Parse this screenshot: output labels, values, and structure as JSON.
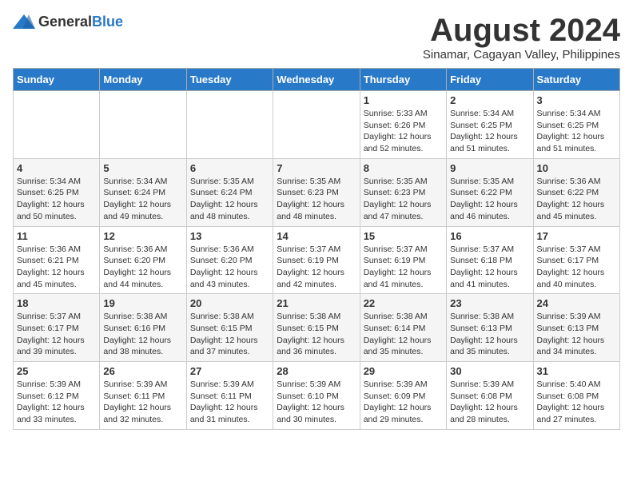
{
  "header": {
    "logo": {
      "general": "General",
      "blue": "Blue"
    },
    "title": "August 2024",
    "subtitle": "Sinamar, Cagayan Valley, Philippines"
  },
  "weekdays": [
    "Sunday",
    "Monday",
    "Tuesday",
    "Wednesday",
    "Thursday",
    "Friday",
    "Saturday"
  ],
  "weeks": [
    [
      {
        "day": "",
        "sunrise": "",
        "sunset": "",
        "daylight": ""
      },
      {
        "day": "",
        "sunrise": "",
        "sunset": "",
        "daylight": ""
      },
      {
        "day": "",
        "sunrise": "",
        "sunset": "",
        "daylight": ""
      },
      {
        "day": "",
        "sunrise": "",
        "sunset": "",
        "daylight": ""
      },
      {
        "day": "1",
        "sunrise": "Sunrise: 5:33 AM",
        "sunset": "Sunset: 6:26 PM",
        "daylight": "Daylight: 12 hours and 52 minutes."
      },
      {
        "day": "2",
        "sunrise": "Sunrise: 5:34 AM",
        "sunset": "Sunset: 6:25 PM",
        "daylight": "Daylight: 12 hours and 51 minutes."
      },
      {
        "day": "3",
        "sunrise": "Sunrise: 5:34 AM",
        "sunset": "Sunset: 6:25 PM",
        "daylight": "Daylight: 12 hours and 51 minutes."
      }
    ],
    [
      {
        "day": "4",
        "sunrise": "Sunrise: 5:34 AM",
        "sunset": "Sunset: 6:25 PM",
        "daylight": "Daylight: 12 hours and 50 minutes."
      },
      {
        "day": "5",
        "sunrise": "Sunrise: 5:34 AM",
        "sunset": "Sunset: 6:24 PM",
        "daylight": "Daylight: 12 hours and 49 minutes."
      },
      {
        "day": "6",
        "sunrise": "Sunrise: 5:35 AM",
        "sunset": "Sunset: 6:24 PM",
        "daylight": "Daylight: 12 hours and 48 minutes."
      },
      {
        "day": "7",
        "sunrise": "Sunrise: 5:35 AM",
        "sunset": "Sunset: 6:23 PM",
        "daylight": "Daylight: 12 hours and 48 minutes."
      },
      {
        "day": "8",
        "sunrise": "Sunrise: 5:35 AM",
        "sunset": "Sunset: 6:23 PM",
        "daylight": "Daylight: 12 hours and 47 minutes."
      },
      {
        "day": "9",
        "sunrise": "Sunrise: 5:35 AM",
        "sunset": "Sunset: 6:22 PM",
        "daylight": "Daylight: 12 hours and 46 minutes."
      },
      {
        "day": "10",
        "sunrise": "Sunrise: 5:36 AM",
        "sunset": "Sunset: 6:22 PM",
        "daylight": "Daylight: 12 hours and 45 minutes."
      }
    ],
    [
      {
        "day": "11",
        "sunrise": "Sunrise: 5:36 AM",
        "sunset": "Sunset: 6:21 PM",
        "daylight": "Daylight: 12 hours and 45 minutes."
      },
      {
        "day": "12",
        "sunrise": "Sunrise: 5:36 AM",
        "sunset": "Sunset: 6:20 PM",
        "daylight": "Daylight: 12 hours and 44 minutes."
      },
      {
        "day": "13",
        "sunrise": "Sunrise: 5:36 AM",
        "sunset": "Sunset: 6:20 PM",
        "daylight": "Daylight: 12 hours and 43 minutes."
      },
      {
        "day": "14",
        "sunrise": "Sunrise: 5:37 AM",
        "sunset": "Sunset: 6:19 PM",
        "daylight": "Daylight: 12 hours and 42 minutes."
      },
      {
        "day": "15",
        "sunrise": "Sunrise: 5:37 AM",
        "sunset": "Sunset: 6:19 PM",
        "daylight": "Daylight: 12 hours and 41 minutes."
      },
      {
        "day": "16",
        "sunrise": "Sunrise: 5:37 AM",
        "sunset": "Sunset: 6:18 PM",
        "daylight": "Daylight: 12 hours and 41 minutes."
      },
      {
        "day": "17",
        "sunrise": "Sunrise: 5:37 AM",
        "sunset": "Sunset: 6:17 PM",
        "daylight": "Daylight: 12 hours and 40 minutes."
      }
    ],
    [
      {
        "day": "18",
        "sunrise": "Sunrise: 5:37 AM",
        "sunset": "Sunset: 6:17 PM",
        "daylight": "Daylight: 12 hours and 39 minutes."
      },
      {
        "day": "19",
        "sunrise": "Sunrise: 5:38 AM",
        "sunset": "Sunset: 6:16 PM",
        "daylight": "Daylight: 12 hours and 38 minutes."
      },
      {
        "day": "20",
        "sunrise": "Sunrise: 5:38 AM",
        "sunset": "Sunset: 6:15 PM",
        "daylight": "Daylight: 12 hours and 37 minutes."
      },
      {
        "day": "21",
        "sunrise": "Sunrise: 5:38 AM",
        "sunset": "Sunset: 6:15 PM",
        "daylight": "Daylight: 12 hours and 36 minutes."
      },
      {
        "day": "22",
        "sunrise": "Sunrise: 5:38 AM",
        "sunset": "Sunset: 6:14 PM",
        "daylight": "Daylight: 12 hours and 35 minutes."
      },
      {
        "day": "23",
        "sunrise": "Sunrise: 5:38 AM",
        "sunset": "Sunset: 6:13 PM",
        "daylight": "Daylight: 12 hours and 35 minutes."
      },
      {
        "day": "24",
        "sunrise": "Sunrise: 5:39 AM",
        "sunset": "Sunset: 6:13 PM",
        "daylight": "Daylight: 12 hours and 34 minutes."
      }
    ],
    [
      {
        "day": "25",
        "sunrise": "Sunrise: 5:39 AM",
        "sunset": "Sunset: 6:12 PM",
        "daylight": "Daylight: 12 hours and 33 minutes."
      },
      {
        "day": "26",
        "sunrise": "Sunrise: 5:39 AM",
        "sunset": "Sunset: 6:11 PM",
        "daylight": "Daylight: 12 hours and 32 minutes."
      },
      {
        "day": "27",
        "sunrise": "Sunrise: 5:39 AM",
        "sunset": "Sunset: 6:11 PM",
        "daylight": "Daylight: 12 hours and 31 minutes."
      },
      {
        "day": "28",
        "sunrise": "Sunrise: 5:39 AM",
        "sunset": "Sunset: 6:10 PM",
        "daylight": "Daylight: 12 hours and 30 minutes."
      },
      {
        "day": "29",
        "sunrise": "Sunrise: 5:39 AM",
        "sunset": "Sunset: 6:09 PM",
        "daylight": "Daylight: 12 hours and 29 minutes."
      },
      {
        "day": "30",
        "sunrise": "Sunrise: 5:39 AM",
        "sunset": "Sunset: 6:08 PM",
        "daylight": "Daylight: 12 hours and 28 minutes."
      },
      {
        "day": "31",
        "sunrise": "Sunrise: 5:40 AM",
        "sunset": "Sunset: 6:08 PM",
        "daylight": "Daylight: 12 hours and 27 minutes."
      }
    ]
  ]
}
